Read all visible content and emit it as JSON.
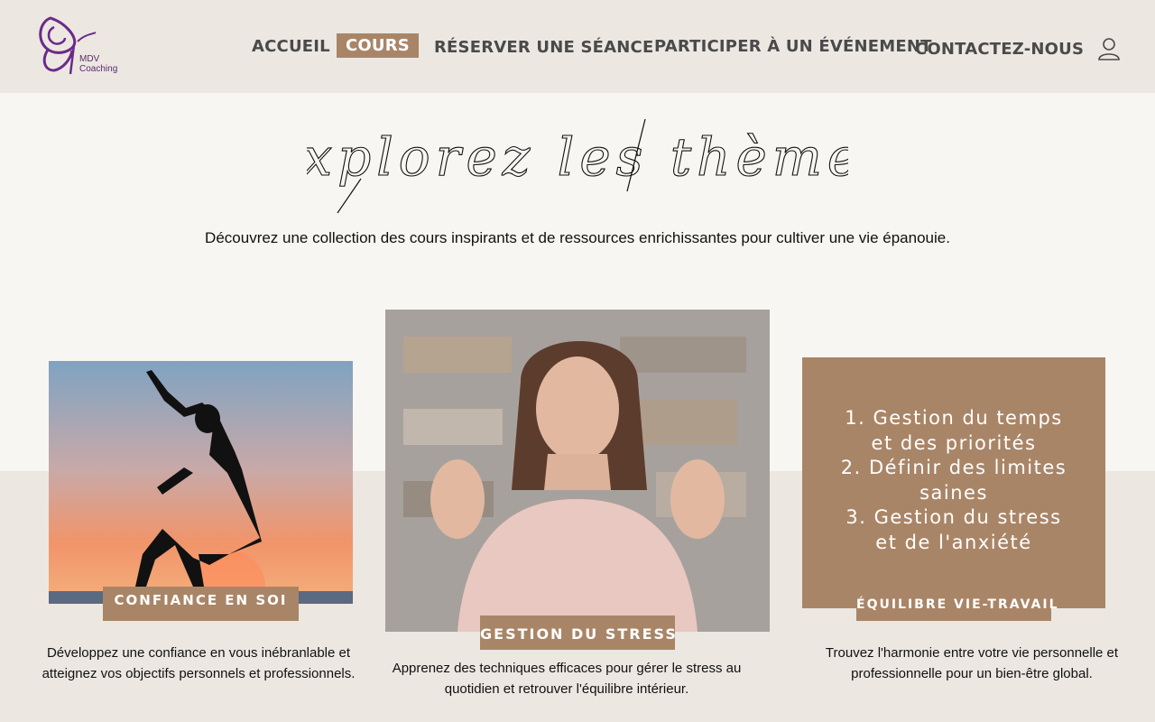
{
  "brand": {
    "line1": "MDV",
    "line2": "Coaching"
  },
  "nav": {
    "items": [
      {
        "label": "Accueil",
        "active": false
      },
      {
        "label": "Cours",
        "active": true
      },
      {
        "label": "Réserver une séance",
        "active": false
      },
      {
        "label": "Participer à un événement",
        "active": false
      },
      {
        "label": "Contactez-nous",
        "active": false
      }
    ],
    "account_icon": "user-icon"
  },
  "hero": {
    "title": "Explorez les thèmes",
    "subtitle": "Découvrez une collection des cours inspirants et de ressources enrichissantes pour cultiver une vie épanouie."
  },
  "cards": [
    {
      "label": "CONFIANCE EN SOI",
      "description_line1": "Développez une confiance en vous inébranlable et",
      "description_line2": "atteignez vos objectifs personnels et professionnels.",
      "image": "silhouette-sunset-photo"
    },
    {
      "label": "GESTION DU STRESS",
      "description_line1": "Apprenez des techniques efficaces pour gérer le stress au",
      "description_line2": "quotidien et retrouver l'équilibre intérieur.",
      "image": "meditating-woman-photo"
    },
    {
      "label": "ÉQUILIBRE VIE-TRAVAIL",
      "description_line1": "Trouvez l'harmonie entre votre vie personnelle et",
      "description_line2": "professionnelle pour un bien-être global.",
      "topics": [
        "1. Gestion du temps",
        "et des priorités",
        "2. Définir des limites",
        "saines",
        "3. Gestion du stress",
        "et de l'anxiété"
      ]
    }
  ],
  "colors": {
    "accent": "#a98567",
    "header_bg": "#ece7e1",
    "page_bg": "#f8f6f3",
    "logo": "#5a2a70"
  }
}
